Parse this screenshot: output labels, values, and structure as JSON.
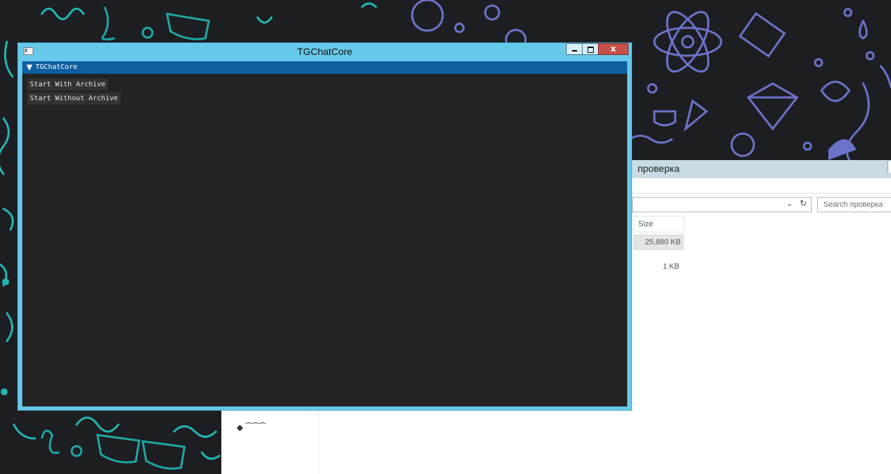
{
  "app_window": {
    "title": "TGChatCore",
    "controls": {
      "minimize_icon": "minimize-icon",
      "maximize_icon": "maximize-icon",
      "close_glyph": "x"
    },
    "panel": {
      "collapse_glyph": "▼",
      "header": "TGChatCore",
      "buttons": [
        "Start With Archive",
        "Start Without Archive"
      ]
    }
  },
  "explorer_window": {
    "title": "проверка",
    "search_placeholder": "Search проверка",
    "size_column_header": "Size",
    "rows": [
      {
        "size": "25,880 KB",
        "selected": true
      },
      {
        "size": "1 KB",
        "selected": false
      }
    ]
  },
  "colors": {
    "app_frame": "#66c9ea",
    "app_client": "#232323",
    "panel_header": "#0f5fa0",
    "button_bg": "#333333",
    "close_button": "#c7504a",
    "wallpaper_bg": "#1c1e22"
  }
}
